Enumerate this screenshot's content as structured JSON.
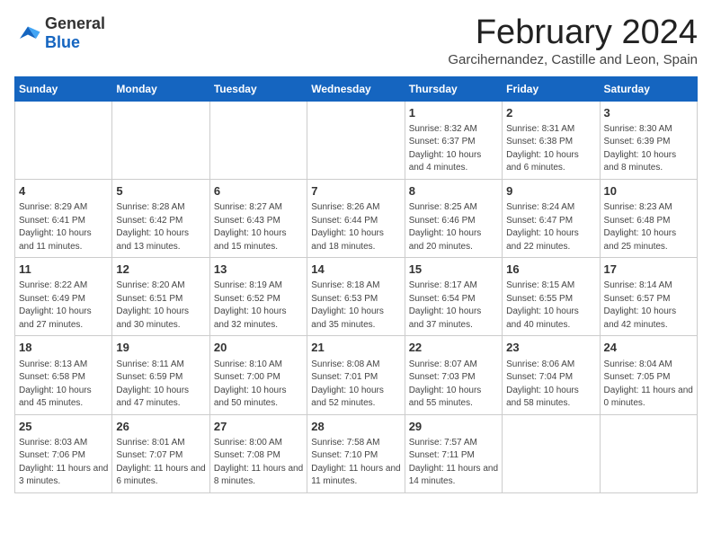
{
  "header": {
    "logo_general": "General",
    "logo_blue": "Blue",
    "month_title": "February 2024",
    "location": "Garcihernandez, Castille and Leon, Spain"
  },
  "days_of_week": [
    "Sunday",
    "Monday",
    "Tuesday",
    "Wednesday",
    "Thursday",
    "Friday",
    "Saturday"
  ],
  "weeks": [
    [
      {
        "day": "",
        "info": ""
      },
      {
        "day": "",
        "info": ""
      },
      {
        "day": "",
        "info": ""
      },
      {
        "day": "",
        "info": ""
      },
      {
        "day": "1",
        "info": "Sunrise: 8:32 AM\nSunset: 6:37 PM\nDaylight: 10 hours\nand 4 minutes."
      },
      {
        "day": "2",
        "info": "Sunrise: 8:31 AM\nSunset: 6:38 PM\nDaylight: 10 hours\nand 6 minutes."
      },
      {
        "day": "3",
        "info": "Sunrise: 8:30 AM\nSunset: 6:39 PM\nDaylight: 10 hours\nand 8 minutes."
      }
    ],
    [
      {
        "day": "4",
        "info": "Sunrise: 8:29 AM\nSunset: 6:41 PM\nDaylight: 10 hours\nand 11 minutes."
      },
      {
        "day": "5",
        "info": "Sunrise: 8:28 AM\nSunset: 6:42 PM\nDaylight: 10 hours\nand 13 minutes."
      },
      {
        "day": "6",
        "info": "Sunrise: 8:27 AM\nSunset: 6:43 PM\nDaylight: 10 hours\nand 15 minutes."
      },
      {
        "day": "7",
        "info": "Sunrise: 8:26 AM\nSunset: 6:44 PM\nDaylight: 10 hours\nand 18 minutes."
      },
      {
        "day": "8",
        "info": "Sunrise: 8:25 AM\nSunset: 6:46 PM\nDaylight: 10 hours\nand 20 minutes."
      },
      {
        "day": "9",
        "info": "Sunrise: 8:24 AM\nSunset: 6:47 PM\nDaylight: 10 hours\nand 22 minutes."
      },
      {
        "day": "10",
        "info": "Sunrise: 8:23 AM\nSunset: 6:48 PM\nDaylight: 10 hours\nand 25 minutes."
      }
    ],
    [
      {
        "day": "11",
        "info": "Sunrise: 8:22 AM\nSunset: 6:49 PM\nDaylight: 10 hours\nand 27 minutes."
      },
      {
        "day": "12",
        "info": "Sunrise: 8:20 AM\nSunset: 6:51 PM\nDaylight: 10 hours\nand 30 minutes."
      },
      {
        "day": "13",
        "info": "Sunrise: 8:19 AM\nSunset: 6:52 PM\nDaylight: 10 hours\nand 32 minutes."
      },
      {
        "day": "14",
        "info": "Sunrise: 8:18 AM\nSunset: 6:53 PM\nDaylight: 10 hours\nand 35 minutes."
      },
      {
        "day": "15",
        "info": "Sunrise: 8:17 AM\nSunset: 6:54 PM\nDaylight: 10 hours\nand 37 minutes."
      },
      {
        "day": "16",
        "info": "Sunrise: 8:15 AM\nSunset: 6:55 PM\nDaylight: 10 hours\nand 40 minutes."
      },
      {
        "day": "17",
        "info": "Sunrise: 8:14 AM\nSunset: 6:57 PM\nDaylight: 10 hours\nand 42 minutes."
      }
    ],
    [
      {
        "day": "18",
        "info": "Sunrise: 8:13 AM\nSunset: 6:58 PM\nDaylight: 10 hours\nand 45 minutes."
      },
      {
        "day": "19",
        "info": "Sunrise: 8:11 AM\nSunset: 6:59 PM\nDaylight: 10 hours\nand 47 minutes."
      },
      {
        "day": "20",
        "info": "Sunrise: 8:10 AM\nSunset: 7:00 PM\nDaylight: 10 hours\nand 50 minutes."
      },
      {
        "day": "21",
        "info": "Sunrise: 8:08 AM\nSunset: 7:01 PM\nDaylight: 10 hours\nand 52 minutes."
      },
      {
        "day": "22",
        "info": "Sunrise: 8:07 AM\nSunset: 7:03 PM\nDaylight: 10 hours\nand 55 minutes."
      },
      {
        "day": "23",
        "info": "Sunrise: 8:06 AM\nSunset: 7:04 PM\nDaylight: 10 hours\nand 58 minutes."
      },
      {
        "day": "24",
        "info": "Sunrise: 8:04 AM\nSunset: 7:05 PM\nDaylight: 11 hours\nand 0 minutes."
      }
    ],
    [
      {
        "day": "25",
        "info": "Sunrise: 8:03 AM\nSunset: 7:06 PM\nDaylight: 11 hours\nand 3 minutes."
      },
      {
        "day": "26",
        "info": "Sunrise: 8:01 AM\nSunset: 7:07 PM\nDaylight: 11 hours\nand 6 minutes."
      },
      {
        "day": "27",
        "info": "Sunrise: 8:00 AM\nSunset: 7:08 PM\nDaylight: 11 hours\nand 8 minutes."
      },
      {
        "day": "28",
        "info": "Sunrise: 7:58 AM\nSunset: 7:10 PM\nDaylight: 11 hours\nand 11 minutes."
      },
      {
        "day": "29",
        "info": "Sunrise: 7:57 AM\nSunset: 7:11 PM\nDaylight: 11 hours\nand 14 minutes."
      },
      {
        "day": "",
        "info": ""
      },
      {
        "day": "",
        "info": ""
      }
    ]
  ]
}
